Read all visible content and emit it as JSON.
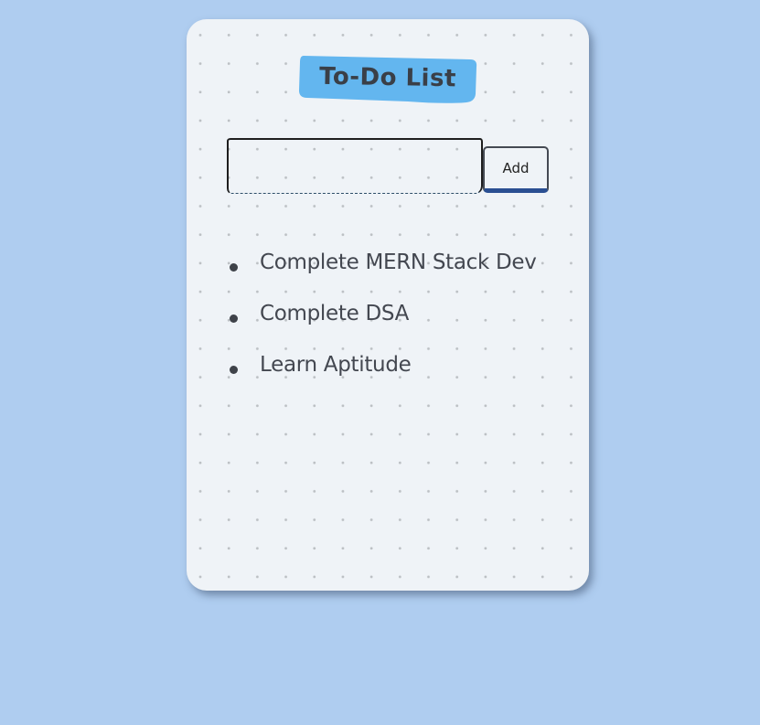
{
  "app": {
    "title": "To-Do List",
    "accent_color": "#63b6ef",
    "button_underline_color": "#2a4f92",
    "background_color": "#afcdf0",
    "card_color": "#eff3f7"
  },
  "form": {
    "input_value": "",
    "input_placeholder": "",
    "add_label": "Add"
  },
  "todos": [
    {
      "text": "Complete MERN Stack Dev"
    },
    {
      "text": "Complete DSA"
    },
    {
      "text": "Learn Aptitude"
    }
  ]
}
